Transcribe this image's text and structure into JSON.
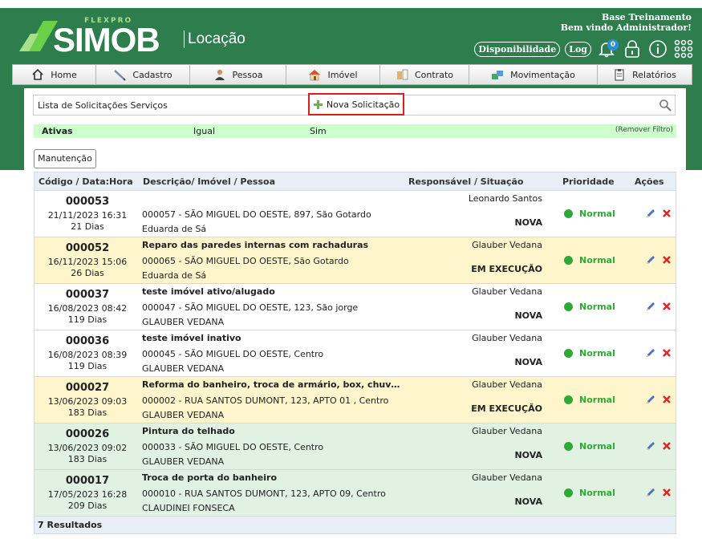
{
  "brand": {
    "flexpro": "FLEXPRO",
    "name": "SIMOB",
    "module": "Locação"
  },
  "header": {
    "base": "Base Treinamento",
    "welcome": "Bem vindo Administrador!",
    "disponibilidade": "Disponibilidade",
    "log": "Log",
    "notifications": "0"
  },
  "nav": [
    {
      "label": "Home",
      "icon": "home-icon"
    },
    {
      "label": "Cadastro",
      "icon": "pencil-icon"
    },
    {
      "label": "Pessoa",
      "icon": "person-icon"
    },
    {
      "label": "Imóvel",
      "icon": "house-icon"
    },
    {
      "label": "Contrato",
      "icon": "contract-icon"
    },
    {
      "label": "Movimentação",
      "icon": "movement-icon"
    },
    {
      "label": "Relatórios",
      "icon": "report-icon"
    }
  ],
  "list": {
    "title": "Lista de Solicitações Serviços",
    "new_label": "Nova Solicitação"
  },
  "filter": {
    "field": "Ativas",
    "op": "Igual",
    "value": "Sim",
    "remove": "(Remover Filtro)"
  },
  "manutencao": "Manutenção",
  "columns": {
    "code": "Código / Data:Hora",
    "desc": "Descrição/ Imóvel / Pessoa",
    "resp": "Responsável / Situação",
    "prio": "Prioridade",
    "acoes": "Ações"
  },
  "rows": [
    {
      "code": "000053",
      "date": "21/11/2023 16:31",
      "days": "21 Dias",
      "desc": "",
      "imovel": "000057 - SÃO MIGUEL DO OESTE, 897, São Gotardo",
      "pessoa": "Eduarda de Sá",
      "resp": "Leonardo Santos",
      "sit": "NOVA",
      "prio": "Normal",
      "style": "plain"
    },
    {
      "code": "000052",
      "date": "16/11/2023 15:06",
      "days": "26 Dias",
      "desc": "Reparo das paredes internas com rachaduras",
      "imovel": "000065 - SÃO MIGUEL DO OESTE, São Gotardo",
      "pessoa": "Eduarda de Sá",
      "resp": "Glauber Vedana",
      "sit": "EM EXECUÇÃO",
      "prio": "Normal",
      "style": "exec"
    },
    {
      "code": "000037",
      "date": "16/08/2023 08:42",
      "days": "119 Dias",
      "desc": "teste imóvel ativo/alugado",
      "imovel": "000047 - SÃO MIGUEL DO OESTE, 123, São jorge",
      "pessoa": "GLAUBER VEDANA",
      "resp": "Glauber Vedana",
      "sit": "NOVA",
      "prio": "Normal",
      "style": "plain"
    },
    {
      "code": "000036",
      "date": "16/08/2023 08:39",
      "days": "119 Dias",
      "desc": "teste imóvel inativo",
      "imovel": "000045 - SÃO MIGUEL DO OESTE, Centro",
      "pessoa": "GLAUBER VEDANA",
      "resp": "Glauber Vedana",
      "sit": "NOVA",
      "prio": "Normal",
      "style": "plain"
    },
    {
      "code": "000027",
      "date": "13/06/2023 09:03",
      "days": "183 Dias",
      "desc": "Reforma do banheiro, troca de armário, box, chuve…",
      "imovel": "000002 - RUA SANTOS DUMONT, 123, APTO 01 , Centro",
      "pessoa": "GLAUBER VEDANA",
      "resp": "Glauber Vedana",
      "sit": "EM EXECUÇÃO",
      "prio": "Normal",
      "style": "exec"
    },
    {
      "code": "000026",
      "date": "13/06/2023 09:02",
      "days": "183 Dias",
      "desc": "Pintura do telhado",
      "imovel": "000033 - SÃO MIGUEL DO OESTE, Centro",
      "pessoa": "GLAUBER VEDANA",
      "resp": "Glauber Vedana",
      "sit": "NOVA",
      "prio": "Normal",
      "style": "green"
    },
    {
      "code": "000017",
      "date": "17/05/2023 16:28",
      "days": "209 Dias",
      "desc": "Troca de porta do banheiro",
      "imovel": "000010 - RUA SANTOS DUMONT, 123, APTO 09, Centro",
      "pessoa": "CLAUDINEI FONSECA",
      "resp": "Glauber Vedana",
      "sit": "NOVA",
      "prio": "Normal",
      "style": "green"
    }
  ],
  "results": "7 Resultados",
  "colors": {
    "header": "#2e7d4d",
    "exec": "#fff5cc",
    "green_row": "#e2f2e2",
    "priority": "#2ea836",
    "highlight": "#e31b1b"
  }
}
